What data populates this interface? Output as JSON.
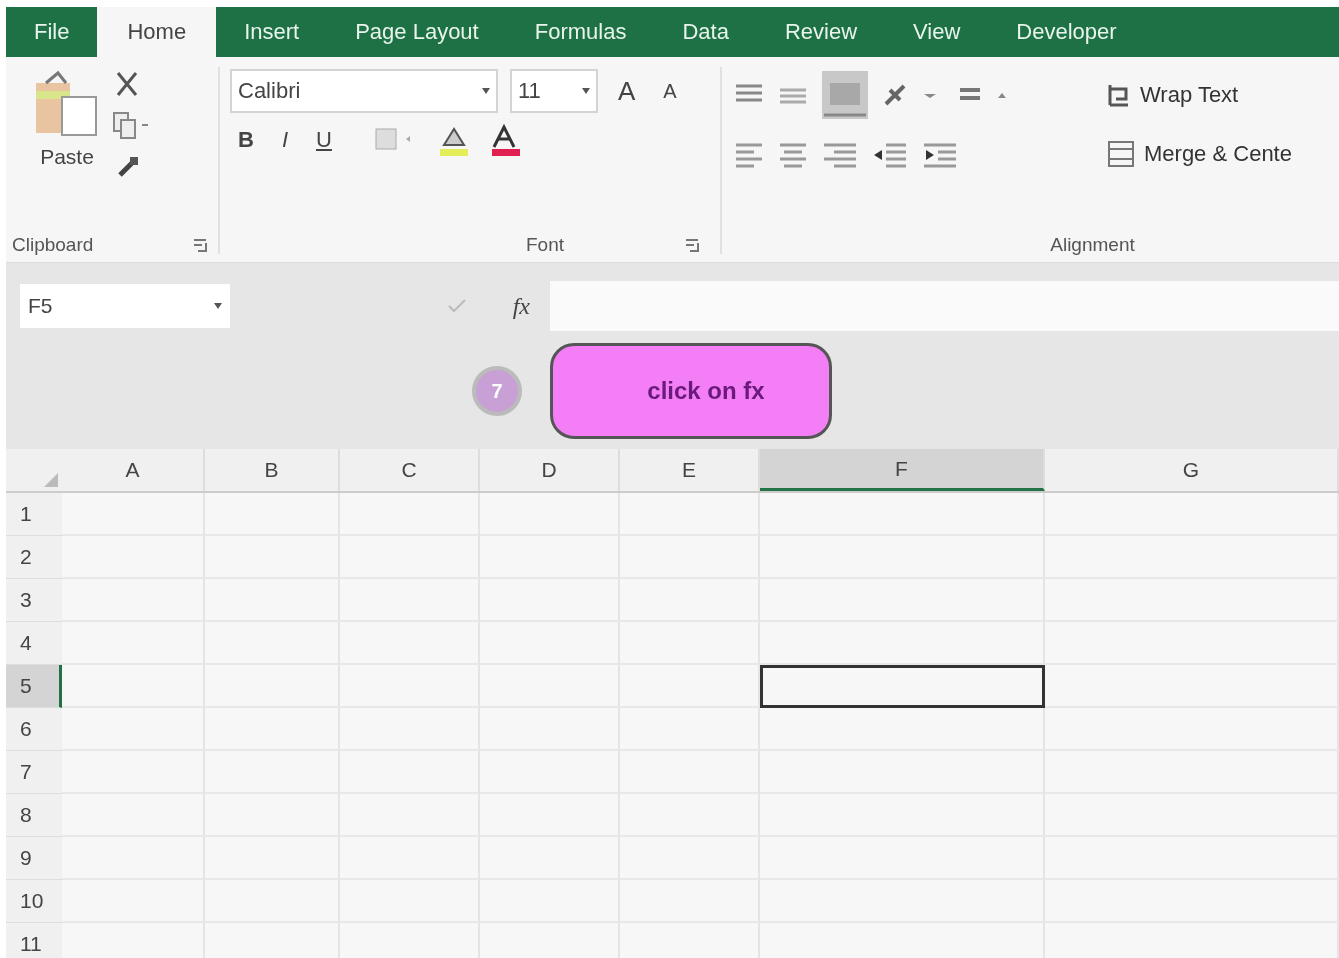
{
  "ribbon_tabs": [
    {
      "label": "File",
      "selected": false
    },
    {
      "label": "Home",
      "selected": true
    },
    {
      "label": "Insert",
      "selected": false
    },
    {
      "label": "Page Layout",
      "selected": false
    },
    {
      "label": "Formulas",
      "selected": false
    },
    {
      "label": "Data",
      "selected": false
    },
    {
      "label": "Review",
      "selected": false
    },
    {
      "label": "View",
      "selected": false
    },
    {
      "label": "Developer",
      "selected": false
    }
  ],
  "clipboard": {
    "paste": "Paste",
    "group_label": "Clipboard"
  },
  "font": {
    "family": "Calibri",
    "size": "11",
    "grow": "A",
    "shrink": "A",
    "bold": "B",
    "italic": "I",
    "underline": "U",
    "group_label": "Font"
  },
  "alignment": {
    "wrap_text": "Wrap Text",
    "merge": "Merge & Cente",
    "group_label": "Alignment"
  },
  "formula_bar": {
    "name_box": "F5",
    "fx": "fx"
  },
  "callout": {
    "step": "7",
    "text": "click on fx"
  },
  "columns": [
    {
      "label": "A",
      "selected": false
    },
    {
      "label": "B",
      "selected": false
    },
    {
      "label": "C",
      "selected": false
    },
    {
      "label": "D",
      "selected": false
    },
    {
      "label": "E",
      "selected": false
    },
    {
      "label": "F",
      "selected": true
    },
    {
      "label": "G",
      "selected": false
    }
  ],
  "rows": [
    {
      "label": "1",
      "selected": false
    },
    {
      "label": "2",
      "selected": false
    },
    {
      "label": "3",
      "selected": false
    },
    {
      "label": "4",
      "selected": false
    },
    {
      "label": "5",
      "selected": true
    },
    {
      "label": "6",
      "selected": false
    },
    {
      "label": "7",
      "selected": false
    },
    {
      "label": "8",
      "selected": false
    },
    {
      "label": "9",
      "selected": false
    },
    {
      "label": "10",
      "selected": false
    },
    {
      "label": "11",
      "selected": false
    }
  ]
}
